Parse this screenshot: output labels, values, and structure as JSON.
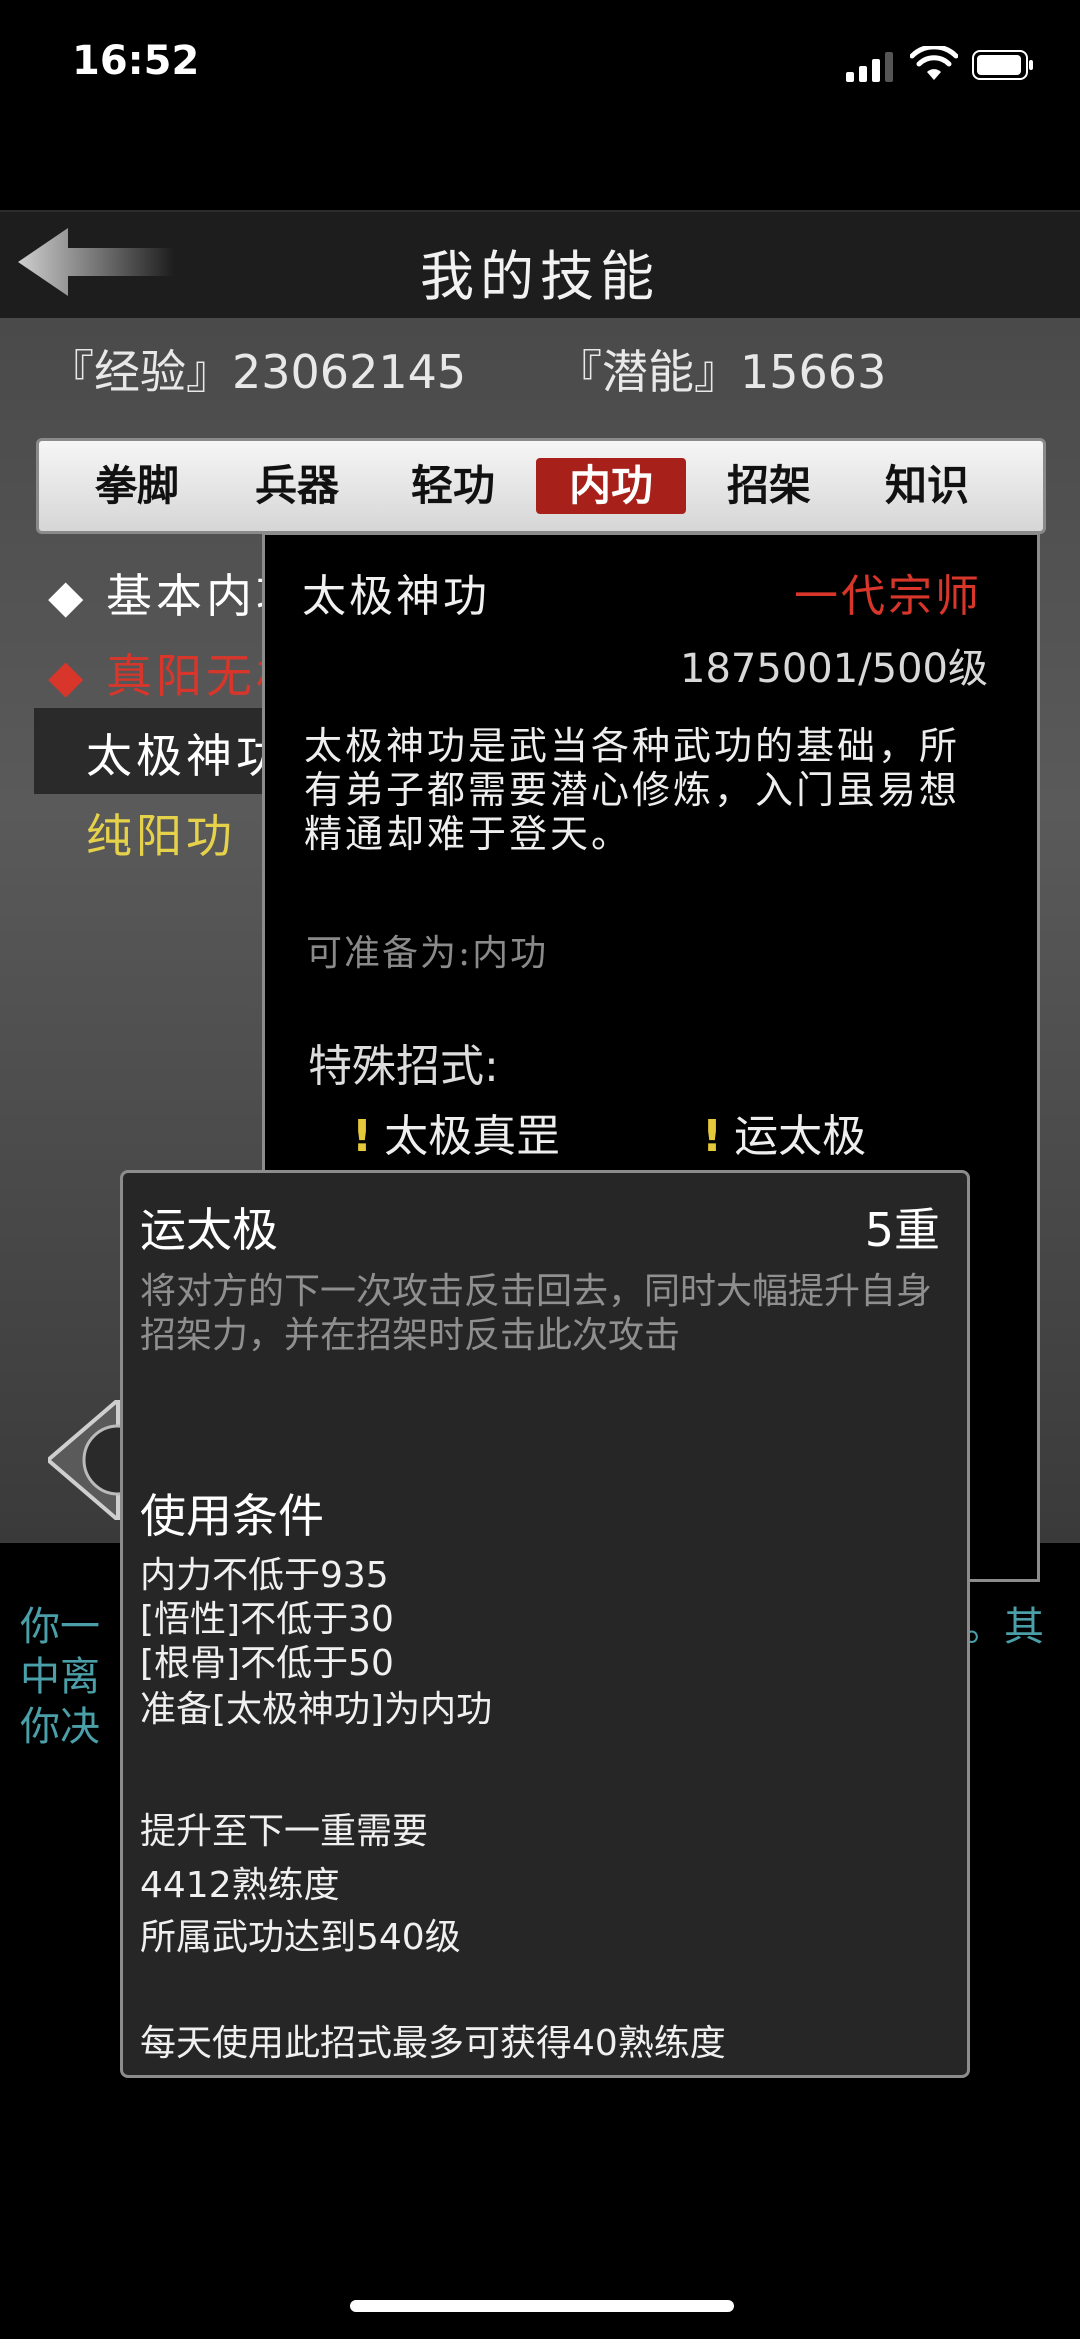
{
  "status_bar": {
    "time": "16:52"
  },
  "header": {
    "title": "我的技能"
  },
  "stats": {
    "experience": "『经验』23062145",
    "potential": "『潜能』15663"
  },
  "tabs": [
    "拳脚",
    "兵器",
    "轻功",
    "内功",
    "招架",
    "知识"
  ],
  "active_tab": "内功",
  "skill_list": [
    {
      "label": "◆ 基本内功",
      "color": "#ffffff"
    },
    {
      "label": "◆ 真阳无极",
      "color": "#d9362b"
    },
    {
      "label": "太极神功",
      "color": "#ffffff"
    },
    {
      "label": "纯阳功",
      "color": "#e6d24a"
    }
  ],
  "skill_detail": {
    "name": "太极神功",
    "rank": "一代宗师",
    "level": "1875001/500级",
    "description": "太极神功是武当各种武功的基础，所有弟子都需要潜心修炼，入门虽易想精通却难于登天。",
    "prepare_as": "可准备为:内功",
    "special_moves_label": "特殊招式:",
    "special_moves": [
      "太极真罡",
      "运太极"
    ]
  },
  "move_detail": {
    "name": "运太极",
    "level": "5重",
    "description": "将对方的下一次攻击反击回去，同时大幅提升自身招架力，并在招架时反击此次攻击",
    "conditions_heading": "使用条件",
    "conditions": [
      "内力不低于935",
      "[悟性]不低于30",
      "[根骨]不低于50",
      "准备[太极神功]为内功"
    ],
    "upgrade_heading": "提升至下一重需要",
    "upgrade": [
      "4412熟练度",
      "所属武功达到540级"
    ],
    "daily_note": "每天使用此招式最多可获得40熟练度"
  },
  "bottom_text": {
    "line1": "你一",
    "line2": "中离",
    "line3": "你决",
    "line1_end": "。其"
  }
}
